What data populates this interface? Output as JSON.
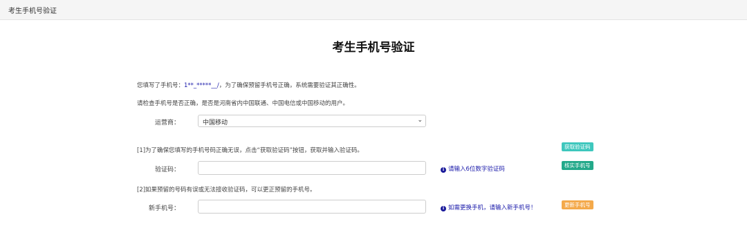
{
  "topbar": {
    "title": "考生手机号验证"
  },
  "page": {
    "title": "考生手机号验证"
  },
  "info": {
    "prefix": "您填写了手机号：",
    "phone": "1**_*****__/",
    "suffix": "，为了确保预留手机号正确，系统需要验证其正确性。",
    "line2": "请检查手机号是否正确，是否是河南省内中国联通、中国电信或中国移动的用户。"
  },
  "carrier": {
    "label": "运营商：",
    "value": "中国移动",
    "icon": "chevron-down-icon"
  },
  "step1": {
    "text": "[1]为了确保您填写的手机号码正确无误，点击“获取验证码”按钮，获取并输入验证码。"
  },
  "code": {
    "label": "验证码：",
    "value": "",
    "hint": "请输入6位数字验证码",
    "hint_icon": "info-icon"
  },
  "step2": {
    "text": "[2]如果预留的号码有误或无法接收验证码，可以更正预留的手机号。"
  },
  "new_phone": {
    "label": "新手机号：",
    "value": "",
    "hint": "如需更换手机，请输入新手机号！",
    "hint_icon": "info-icon"
  },
  "buttons": {
    "get_code": "获取验证码",
    "verify_phone": "核实手机号",
    "update_phone": "更新手机号"
  },
  "colors": {
    "get_code": "#3ec7bd",
    "verify_phone": "#23a98a",
    "update_phone": "#f4a94a",
    "hint": "#1a1aaa"
  }
}
